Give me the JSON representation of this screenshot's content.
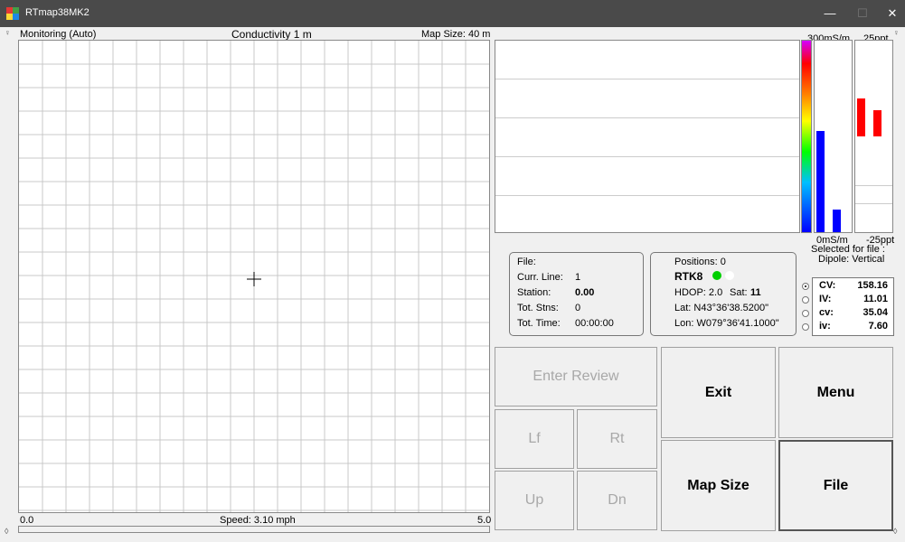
{
  "window": {
    "title": "RTmap38MK2",
    "min_label": "—",
    "max_label": "☐",
    "close_label": "✕"
  },
  "map": {
    "mode": "Monitoring (Auto)",
    "title": "Conductivity 1 m",
    "size_label": "Map Size:  40 m",
    "scale_min": "0.0",
    "scale_max": "5.0",
    "speed": "Speed:  3.10 mph"
  },
  "chart": {
    "top_left_label": "300mS/m",
    "top_right_label": "25ppt",
    "bottom_left_label": "0mS/m",
    "bottom_right_label": "-25ppt",
    "selected_line1": "Selected for file :",
    "selected_line2": "Dipole: Vertical",
    "colors": {
      "blue_bar": "#0000ff",
      "red_bar": "#ff0000"
    }
  },
  "chart_data": {
    "type": "bar",
    "conductivity_bars": {
      "unit": "mS/m",
      "range": [
        0,
        300
      ],
      "values": [
        158,
        35
      ]
    },
    "inphase_bars": {
      "unit": "ppt",
      "range": [
        -25,
        25
      ],
      "values": [
        11,
        7.6
      ]
    }
  },
  "file_panel": {
    "file_label": "File:",
    "curr_line_label": "Curr. Line:",
    "curr_line": "1",
    "station_label": "Station:",
    "station": "0.00",
    "tot_stns_label": "Tot. Stns:",
    "tot_stns": "0",
    "tot_time_label": "Tot. Time:",
    "tot_time": "00:00:00"
  },
  "gps_panel": {
    "positions": "Positions:  0",
    "mode": "RTK8",
    "hdop": "HDOP: 2.0",
    "sat_label": "Sat:",
    "sat": "11",
    "lat": "Lat:  N43°36'38.5200\"",
    "lon": "Lon:  W079°36'41.1000\""
  },
  "readings": [
    {
      "label": "CV:",
      "value": "158.16",
      "selected": true
    },
    {
      "label": "IV:",
      "value": "11.01",
      "selected": false
    },
    {
      "label": "cv:",
      "value": "35.04",
      "selected": false
    },
    {
      "label": "iv:",
      "value": "7.60",
      "selected": false
    }
  ],
  "buttons": {
    "enter_review": "Enter Review",
    "lf": "Lf",
    "rt": "Rt",
    "up": "Up",
    "dn": "Dn",
    "exit": "Exit",
    "menu": "Menu",
    "map_size": "Map Size",
    "file": "File"
  }
}
